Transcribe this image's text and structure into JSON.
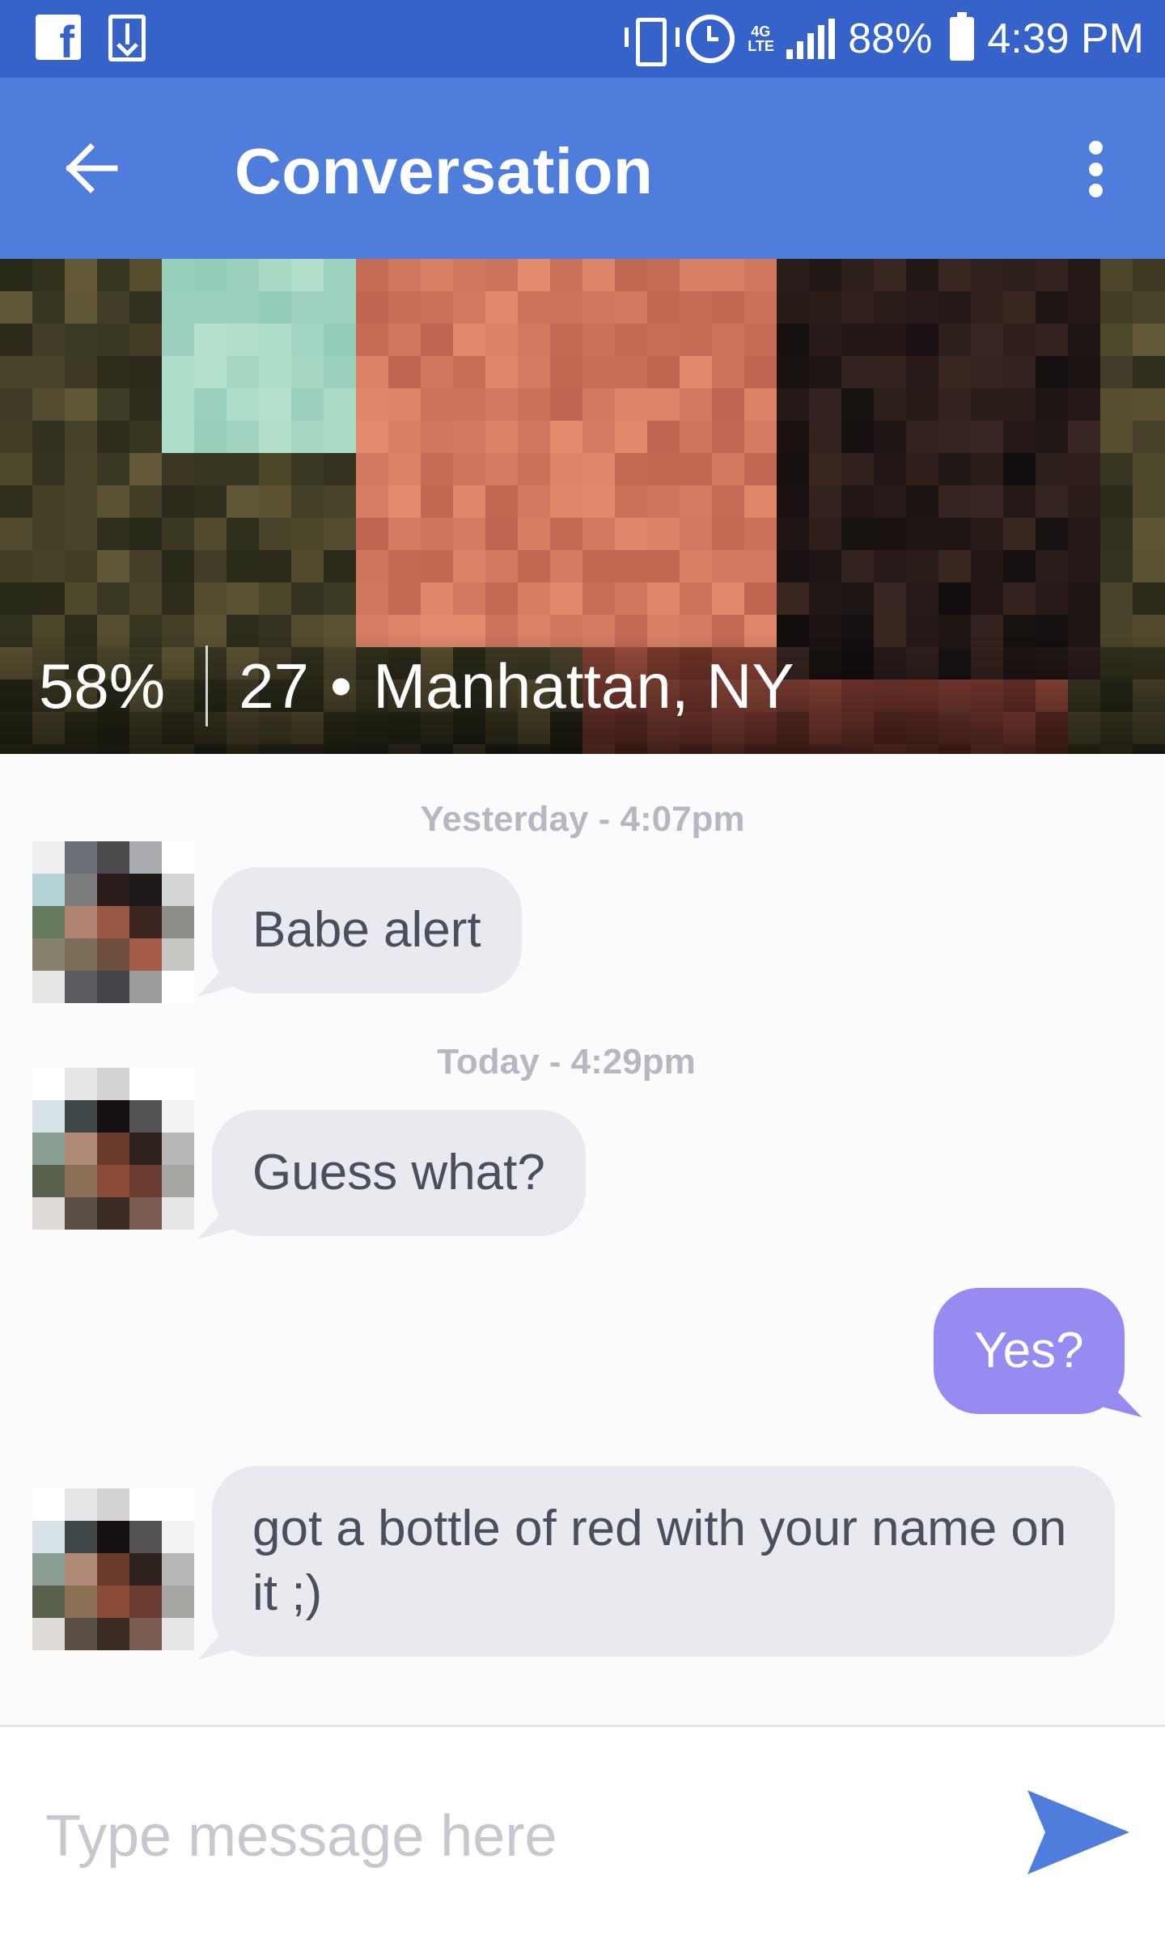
{
  "status_bar": {
    "left_icons": [
      "facebook-icon",
      "download-icon"
    ],
    "right_icons": [
      "vibrate-icon",
      "alarm-icon",
      "4g-lte-icon",
      "signal-icon",
      "battery-icon"
    ],
    "network_label": "4G LTE",
    "battery": "88%",
    "time": "4:39 PM"
  },
  "app_bar": {
    "title": "Conversation",
    "back_icon": "arrow-left-icon",
    "menu_icon": "more-vertical-icon"
  },
  "profile": {
    "match": "58%",
    "age": "27",
    "separator": "•",
    "location": "Manhattan, NY"
  },
  "messages": [
    {
      "timestamp": "Yesterday - 4:07pm",
      "direction": "incoming",
      "text": "Babe alert"
    },
    {
      "timestamp": "Today - 4:29pm",
      "direction": "incoming",
      "text": "Guess what?"
    },
    {
      "direction": "outgoing",
      "text": "Yes?"
    },
    {
      "direction": "incoming",
      "text": "got a bottle of red with your name on it ;)"
    }
  ],
  "composer": {
    "placeholder": "Type message here",
    "send_icon": "send-icon"
  },
  "colors": {
    "status_bar": "#3563c9",
    "app_bar": "#4f7ddb",
    "incoming_bubble": "#e9eaef",
    "outgoing_bubble": "#958bf0",
    "send_accent": "#4f7ddb"
  }
}
